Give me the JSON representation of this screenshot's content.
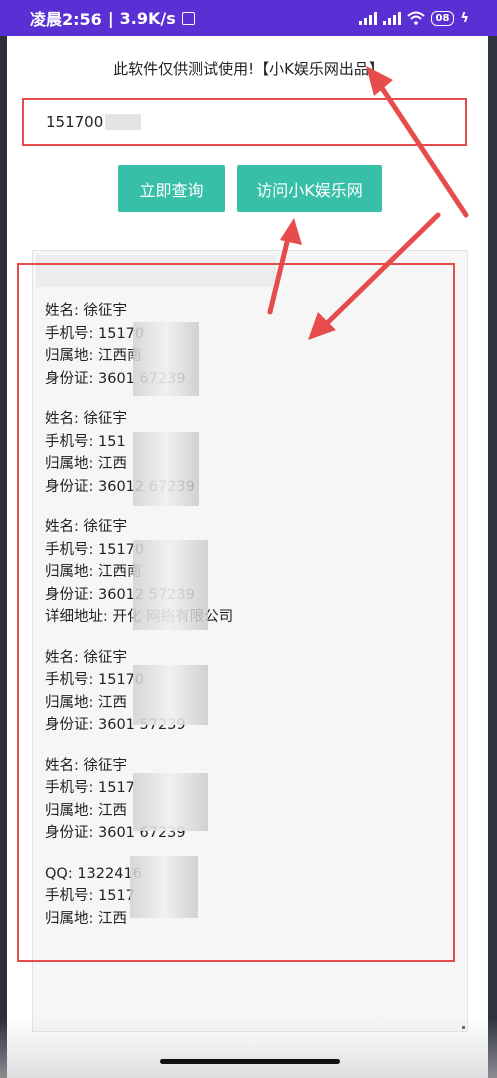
{
  "status_bar": {
    "time": "凌晨2:56",
    "speed": "3.9K/s",
    "battery": "08"
  },
  "app": {
    "notice": "此软件仅供测试使用!【小K娱乐网出品】",
    "phone_input_value": "151700",
    "query_button": "立即查询",
    "visit_button": "访问小K娱乐网"
  },
  "records": [
    {
      "lines": [
        "姓名: 徐征宇",
        "手机号: 15170",
        "归属地: 江西南",
        "身份证: 3601           67239"
      ]
    },
    {
      "lines": [
        "姓名: 徐征宇",
        "手机号: 151",
        "归属地: 江西",
        "身份证: 36012          67239"
      ]
    },
    {
      "lines": [
        "姓名: 徐征宇",
        "手机号: 15170",
        "归属地: 江西南",
        "身份证: 36012          57239",
        "详细地址: 开化                网络有限公司"
      ]
    },
    {
      "lines": [
        "姓名: 徐征宇",
        "手机号: 15170",
        "归属地: 江西",
        "身份证: 3601           57239"
      ]
    },
    {
      "lines": [
        "姓名: 徐征宇",
        "手机号: 1517",
        "归属地: 江西",
        "身份证: 3601           67239"
      ]
    },
    {
      "lines": [
        "QQ: 1322416",
        "手机号: 1517",
        "归属地: 江西"
      ]
    }
  ],
  "colors": {
    "status_bar": "#5a2fd3",
    "button": "#38bfa8",
    "annotation_red": "#e74c4c"
  }
}
